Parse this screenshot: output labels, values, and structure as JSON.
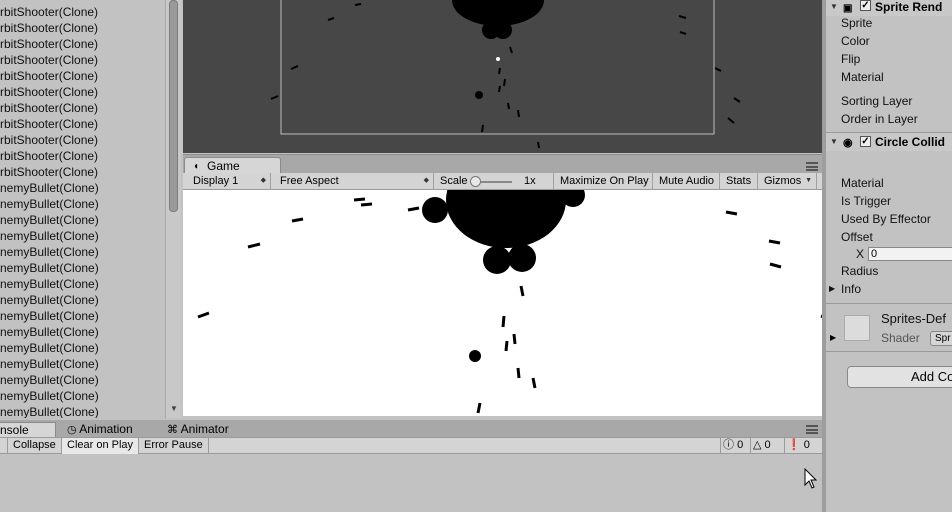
{
  "hierarchy": {
    "items": [
      "rbitShooter(Clone)",
      "rbitShooter(Clone)",
      "rbitShooter(Clone)",
      "rbitShooter(Clone)",
      "rbitShooter(Clone)",
      "rbitShooter(Clone)",
      "rbitShooter(Clone)",
      "rbitShooter(Clone)",
      "rbitShooter(Clone)",
      "rbitShooter(Clone)",
      "rbitShooter(Clone)",
      "nemyBullet(Clone)",
      "nemyBullet(Clone)",
      "nemyBullet(Clone)",
      "nemyBullet(Clone)",
      "nemyBullet(Clone)",
      "nemyBullet(Clone)",
      "nemyBullet(Clone)",
      "nemyBullet(Clone)",
      "nemyBullet(Clone)",
      "nemyBullet(Clone)",
      "nemyBullet(Clone)",
      "nemyBullet(Clone)",
      "nemyBullet(Clone)",
      "nemyBullet(Clone)",
      "nemyBullet(Clone)"
    ]
  },
  "game": {
    "tab_label": "Game",
    "display": "Display 1",
    "aspect": "Free Aspect",
    "scale_label": "Scale",
    "scale_value": "1x",
    "maximize": "Maximize On Play",
    "mute": "Mute Audio",
    "stats": "Stats",
    "gizmos": "Gizmos"
  },
  "console": {
    "tabs": [
      "nsole",
      "Animation",
      "Animator"
    ],
    "collapse": "Collapse",
    "clear_on_play": "Clear on Play",
    "error_pause": "Error Pause",
    "log_count": "0",
    "warning_count": "0",
    "error_count": "0"
  },
  "inspector": {
    "sprite_renderer_title": "Sprite Rend",
    "sprite_renderer_fields": [
      "Sprite",
      "Color",
      "Flip",
      "Material"
    ],
    "sorting_layer": "Sorting Layer",
    "order_in_layer": "Order in Layer",
    "circle_collider_title": "Circle Collid",
    "collider_fields": [
      "Material",
      "Is Trigger",
      "Used By Effector",
      "Offset"
    ],
    "offset_x_label": "X",
    "offset_x_value": "0",
    "radius": "Radius",
    "info": "Info",
    "material_name": "Sprites-Def",
    "shader_label": "Shader",
    "shader_value": "Spr",
    "add_component": "Add Co"
  }
}
